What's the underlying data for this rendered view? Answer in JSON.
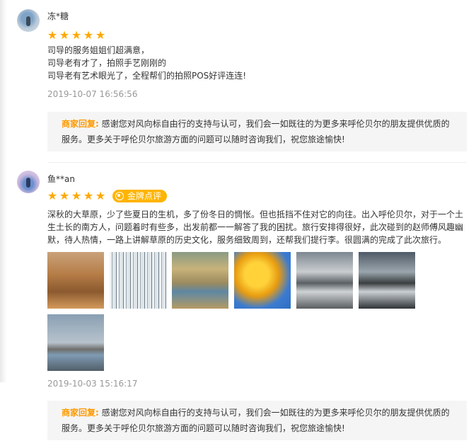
{
  "reviews": [
    {
      "user": "冻*糖",
      "rating": 5,
      "lines": [
        "司导的服务姐姐们超满意，",
        "司导老有才了，拍照手艺刚刚的",
        "司导老有艺术眼光了，全程帮们的拍照POS好评连连!"
      ],
      "time": "2019-10-07 16:56:56",
      "reply_label": "商家回复:",
      "reply_text_1": "感谢您对风向标自由行的支持与认可，我们会一如既往的为更多来呼伦贝尔的朋友提供优质的",
      "reply_text_2": "服务。更多关于呼伦贝尔旅游方面的问题可以随时咨询我们，祝您旅途愉快!"
    },
    {
      "user": "鱼**an",
      "rating": 5,
      "badge": "金牌点评",
      "lines": [
        "深秋的大草原，少了些夏日的生机，多了份冬日的惆怅。但也抵挡不住对它的向往。出入呼伦贝尔，对于一个土",
        "生土长的南方人，问题着时有些多，出发前都一一解答了我的困扰。旅行安排得很好，此次碰到的赵师傅风趣幽",
        "默，待人热情，一路上讲解草原的历史文化，服务细致周到，还帮我们提行李。很圆满的完成了此次旅行。"
      ],
      "time": "2019-10-03 15:16:17",
      "reply_label": "商家回复:",
      "reply_text_1": "感谢您对风向标自由行的支持与认可，我们会一如既往的为更多来呼伦贝尔的朋友提供优质的",
      "reply_text_2": "服务。更多关于呼伦贝尔旅游方面的问题可以随时咨询我们，祝您旅途愉快!"
    }
  ],
  "icons": {
    "star": "star-icon",
    "badge": "medal-icon"
  },
  "colors": {
    "star": "#ffa800",
    "badge": "#ffb400",
    "reply_label": "#ff9900",
    "timestamp": "#999999"
  }
}
